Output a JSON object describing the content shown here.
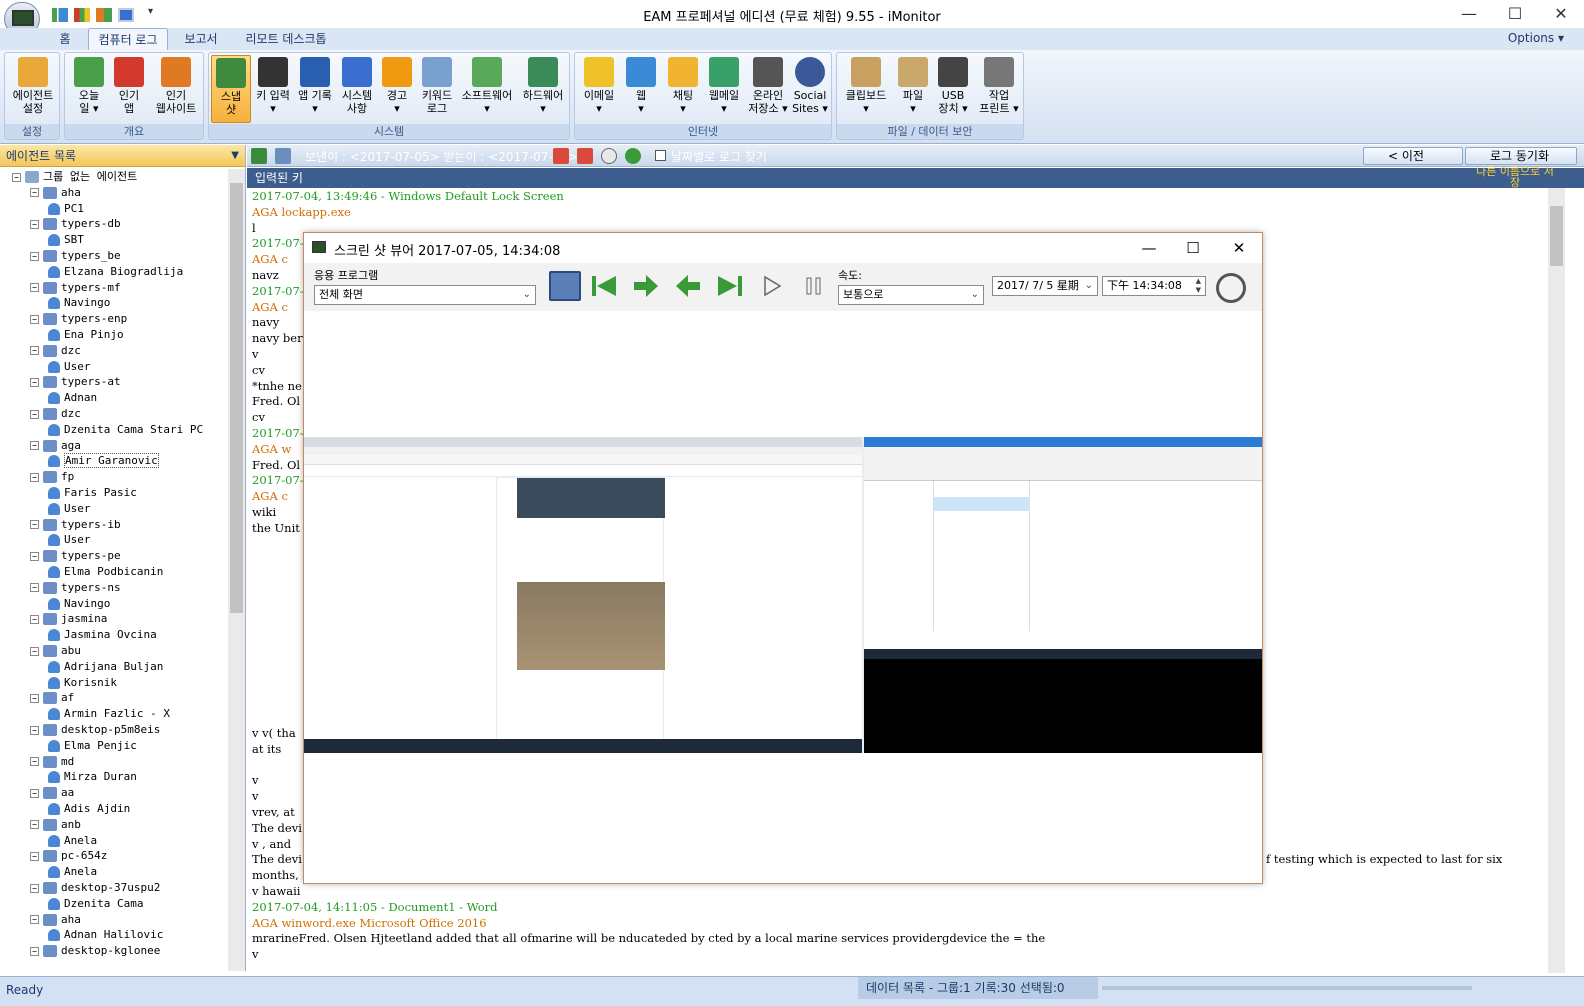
{
  "window": {
    "title": "EAM 프로페셔널 에디션 (무료 체험) 9.55 - iMonitor",
    "minimize": "—",
    "maximize": "☐",
    "close": "✕"
  },
  "tabs": [
    {
      "label": "홈"
    },
    {
      "label": "컴퓨터 로그"
    },
    {
      "label": "보고서"
    },
    {
      "label": "리모트 데스크톱"
    }
  ],
  "options_label": "Options ▾",
  "ribbon": {
    "groups": [
      {
        "label": "설정",
        "buttons": [
          {
            "label": "에이전트\n설정",
            "color": "#e8a93a"
          }
        ]
      },
      {
        "label": "개요",
        "buttons": [
          {
            "label": "오늘\n일 ▾",
            "color": "#4aa04a"
          },
          {
            "label": "인기\n앱",
            "color": "#d33a2e"
          },
          {
            "label": "인기\n웹사이트",
            "color": "#e07a22"
          }
        ]
      },
      {
        "label": "시스템",
        "buttons": [
          {
            "label": "스냅\n샷",
            "color": "#3f8a3f"
          },
          {
            "label": "키 입력\n▾",
            "color": "#333333"
          },
          {
            "label": "앱 기록\n▾",
            "color": "#2a5fb0"
          },
          {
            "label": "시스템\n사항",
            "color": "#3a6fd0"
          },
          {
            "label": "경고\n▾",
            "color": "#f09a12"
          },
          {
            "label": "키워드\n로그",
            "color": "#7aa0d0"
          },
          {
            "label": "소프트웨어\n▾",
            "color": "#5aa85a"
          },
          {
            "label": "하드웨어\n▾",
            "color": "#3a8a5a"
          }
        ]
      },
      {
        "label": "인터넷",
        "buttons": [
          {
            "label": "이메일\n▾",
            "color": "#f0c22a"
          },
          {
            "label": "웹\n▾",
            "color": "#3a8ad6"
          },
          {
            "label": "채팅\n▾",
            "color": "#f0b432"
          },
          {
            "label": "웹메일\n▾",
            "color": "#3aa06a"
          },
          {
            "label": "온라인\n저장소 ▾",
            "color": "#555555"
          },
          {
            "label": "Social\nSites ▾",
            "color": "#3b5998"
          }
        ]
      },
      {
        "label": "파일 / 데이터 보안",
        "buttons": [
          {
            "label": "클립보드\n▾",
            "color": "#c8a060"
          },
          {
            "label": "파일\n▾",
            "color": "#caa76a"
          },
          {
            "label": "USB\n장치 ▾",
            "color": "#444444"
          },
          {
            "label": "작업\n프린트 ▾",
            "color": "#777777"
          }
        ]
      }
    ]
  },
  "left_pane": {
    "header": "에이전트 목록",
    "tree": [
      {
        "label": "그룹 없는 에이전트",
        "level": 0,
        "kind": "root"
      },
      {
        "label": "aha",
        "level": 1,
        "kind": "grp"
      },
      {
        "label": "PC1",
        "level": 2,
        "kind": "user"
      },
      {
        "label": "typers-db",
        "level": 1,
        "kind": "grp"
      },
      {
        "label": "SBT",
        "level": 2,
        "kind": "user"
      },
      {
        "label": "typers_be",
        "level": 1,
        "kind": "grp"
      },
      {
        "label": "Elzana Biogradlija",
        "level": 2,
        "kind": "user"
      },
      {
        "label": "typers-mf",
        "level": 1,
        "kind": "grp"
      },
      {
        "label": "Navingo",
        "level": 2,
        "kind": "user"
      },
      {
        "label": "typers-enp",
        "level": 1,
        "kind": "grp"
      },
      {
        "label": "Ena Pinjo",
        "level": 2,
        "kind": "user"
      },
      {
        "label": "dzc",
        "level": 1,
        "kind": "grp"
      },
      {
        "label": "User",
        "level": 2,
        "kind": "user"
      },
      {
        "label": "typers-at",
        "level": 1,
        "kind": "grp"
      },
      {
        "label": "Adnan",
        "level": 2,
        "kind": "user"
      },
      {
        "label": "dzc",
        "level": 1,
        "kind": "grp"
      },
      {
        "label": "Dzenita Cama Stari PC",
        "level": 2,
        "kind": "user"
      },
      {
        "label": "aga",
        "level": 1,
        "kind": "grp"
      },
      {
        "label": "Amir Garanovic",
        "level": 2,
        "kind": "user",
        "selected": true
      },
      {
        "label": "fp",
        "level": 1,
        "kind": "grp"
      },
      {
        "label": "Faris Pasic",
        "level": 2,
        "kind": "user"
      },
      {
        "label": "User",
        "level": 2,
        "kind": "user"
      },
      {
        "label": "typers-ib",
        "level": 1,
        "kind": "grp"
      },
      {
        "label": "User",
        "level": 2,
        "kind": "user"
      },
      {
        "label": "typers-pe",
        "level": 1,
        "kind": "grp"
      },
      {
        "label": "Elma Podbicanin",
        "level": 2,
        "kind": "user"
      },
      {
        "label": "typers-ns",
        "level": 1,
        "kind": "grp"
      },
      {
        "label": "Navingo",
        "level": 2,
        "kind": "user"
      },
      {
        "label": "jasmina",
        "level": 1,
        "kind": "grp"
      },
      {
        "label": "Jasmina Ovcina",
        "level": 2,
        "kind": "user"
      },
      {
        "label": "abu",
        "level": 1,
        "kind": "grp"
      },
      {
        "label": "Adrijana Buljan",
        "level": 2,
        "kind": "user"
      },
      {
        "label": "Korisnik",
        "level": 2,
        "kind": "user"
      },
      {
        "label": "af",
        "level": 1,
        "kind": "grp"
      },
      {
        "label": "Armin Fazlic - X",
        "level": 2,
        "kind": "user"
      },
      {
        "label": "desktop-p5m8eis",
        "level": 1,
        "kind": "grp"
      },
      {
        "label": "Elma Penjic",
        "level": 2,
        "kind": "user"
      },
      {
        "label": "md",
        "level": 1,
        "kind": "grp"
      },
      {
        "label": "Mirza Duran",
        "level": 2,
        "kind": "user"
      },
      {
        "label": "aa",
        "level": 1,
        "kind": "grp"
      },
      {
        "label": "Adis Ajdin",
        "level": 2,
        "kind": "user"
      },
      {
        "label": "anb",
        "level": 1,
        "kind": "grp"
      },
      {
        "label": "Anela",
        "level": 2,
        "kind": "user"
      },
      {
        "label": "pc-654z",
        "level": 1,
        "kind": "grp"
      },
      {
        "label": "Anela",
        "level": 2,
        "kind": "user"
      },
      {
        "label": "desktop-37uspu2",
        "level": 1,
        "kind": "grp"
      },
      {
        "label": "Dzenita Cama",
        "level": 2,
        "kind": "user"
      },
      {
        "label": "aha",
        "level": 1,
        "kind": "grp"
      },
      {
        "label": "Adnan Halilovic",
        "level": 2,
        "kind": "user"
      },
      {
        "label": "desktop-kglonee",
        "level": 1,
        "kind": "grp"
      }
    ]
  },
  "toolbar": {
    "range_text": "보낸이 : <2017-07-05> 받는이 : <2017-07-05>",
    "find_by_date": "날짜별로 로그 찾기",
    "prev_label": "< 이전",
    "sync_label": "로그 동기화"
  },
  "keys_header": "입력된 키",
  "keys_right": "나른 이름으로 서 장",
  "log_lines": [
    {
      "text": "2017-07-04, 13:49:46 - Windows Default Lock Screen",
      "c": "g"
    },
    {
      "text": "AGA   lockapp.exe",
      "c": "o"
    },
    {
      "text": "l",
      "c": ""
    },
    {
      "text": "2017-07-0",
      "c": "g"
    },
    {
      "text": "AGA   c",
      "c": "o"
    },
    {
      "text": "navz",
      "c": ""
    },
    {
      "text": "2017-07-0",
      "c": "g"
    },
    {
      "text": "AGA   c",
      "c": "o"
    },
    {
      "text": "navy",
      "c": ""
    },
    {
      "text": "navy ber",
      "c": ""
    },
    {
      "text": "v",
      "c": ""
    },
    {
      "text": "cv",
      "c": ""
    },
    {
      "text": "*tnhe ne",
      "c": ""
    },
    {
      "text": "Fred. Ol",
      "c": ""
    },
    {
      "text": "cv",
      "c": ""
    },
    {
      "text": "2017-07-0",
      "c": "g"
    },
    {
      "text": "AGA   w",
      "c": "o"
    },
    {
      "text": "Fred. Ol",
      "c": ""
    },
    {
      "text": "2017-07-0",
      "c": "g"
    },
    {
      "text": "AGA   c",
      "c": "o"
    },
    {
      "text": "wiki",
      "c": ""
    },
    {
      "text": "the Unit",
      "c": ""
    }
  ],
  "log_lines_bottom": [
    {
      "text": "v v( tha",
      "c": ""
    },
    {
      "text": " at its",
      "c": ""
    },
    {
      "text": "",
      "c": ""
    },
    {
      "text": "v",
      "c": ""
    },
    {
      "text": "v",
      "c": ""
    },
    {
      "text": "vrev, at",
      "c": ""
    },
    {
      "text": "The devi",
      "c": ""
    },
    {
      "text": "v , and",
      "c": ""
    },
    {
      "text": "The devi",
      "c": ""
    },
    {
      "text": "months,",
      "c": ""
    },
    {
      "text": "v hawaii",
      "c": ""
    },
    {
      "text": "2017-07-04, 14:11:05 - Document1 - Word",
      "c": "g"
    },
    {
      "text": "AGA   winword.exe   Microsoft Office 2016",
      "c": "o"
    },
    {
      "text": "mrarineFred. Olsen Hjteetland added that all ofmarine  will be nducateded by cted by a local marine services providergdevice the = the",
      "c": ""
    },
    {
      "text": "v",
      "c": ""
    }
  ],
  "log_tail_right": "f testing which is expected to last for six",
  "status": {
    "left": "Ready",
    "mid": "데이터 목록 - 그룹:1 기록:30 선택됨:0"
  },
  "viewer": {
    "title": "스크린 샷 뷰어 2017-07-05, 14:34:08",
    "app_label": "응용 프로그램",
    "app_value": "전체 화면",
    "speed_label": "속도:",
    "speed_value": "보통으로",
    "date_value": "2017/ 7/ 5 星期",
    "time_value": "下午 14:34:08"
  }
}
